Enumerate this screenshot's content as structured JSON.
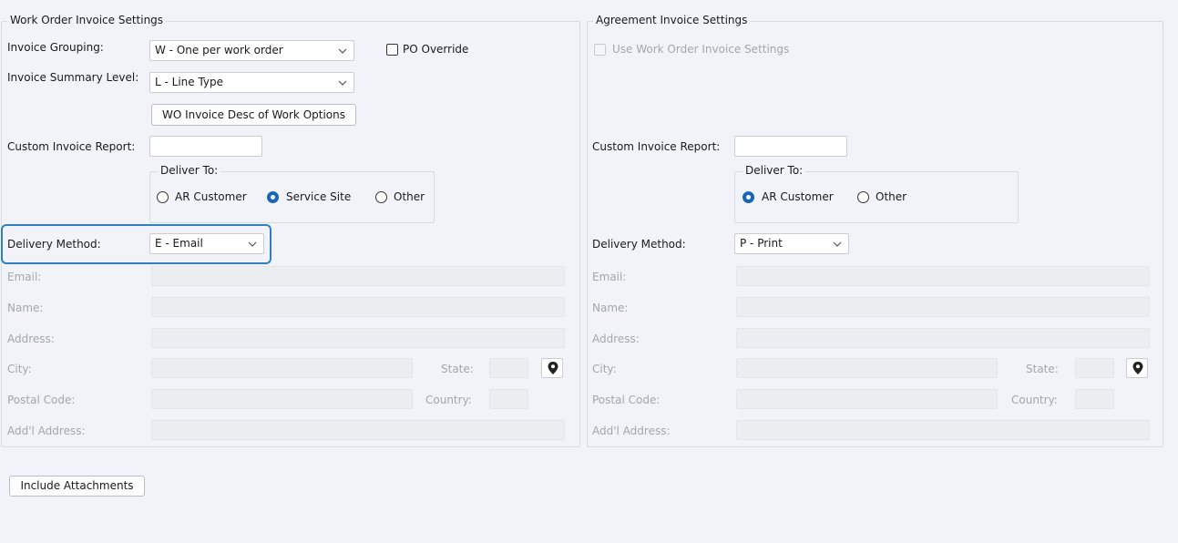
{
  "wo": {
    "title": "Work Order Invoice Settings",
    "invoice_grouping_label": "Invoice Grouping:",
    "invoice_grouping_value": "W - One per work order",
    "po_override_label": "PO Override",
    "summary_level_label": "Invoice Summary Level:",
    "summary_level_value": "L - Line Type",
    "desc_options_button": "WO Invoice Desc of Work Options",
    "custom_report_label": "Custom Invoice Report:",
    "deliver_to_title": "Deliver To:",
    "deliver_options": [
      "AR Customer",
      "Service Site",
      "Other"
    ],
    "deliver_selected": "Service Site",
    "delivery_method_label": "Delivery Method:",
    "delivery_method_value": "E - Email",
    "fields": {
      "email": "Email:",
      "name": "Name:",
      "address": "Address:",
      "city": "City:",
      "state": "State:",
      "postal": "Postal Code:",
      "country": "Country:",
      "addl": "Add'l Address:"
    }
  },
  "ag": {
    "title": "Agreement Invoice Settings",
    "use_wo_label": "Use Work Order Invoice Settings",
    "custom_report_label": "Custom Invoice Report:",
    "deliver_to_title": "Deliver To:",
    "deliver_options": [
      "AR Customer",
      "Other"
    ],
    "deliver_selected": "AR Customer",
    "delivery_method_label": "Delivery Method:",
    "delivery_method_value": "P - Print",
    "fields": {
      "email": "Email:",
      "name": "Name:",
      "address": "Address:",
      "city": "City:",
      "state": "State:",
      "postal": "Postal Code:",
      "country": "Country:",
      "addl": "Add'l Address:"
    }
  },
  "include_attachments_button": "Include Attachments",
  "colors": {
    "accent": "#1766b7",
    "highlight": "#2f7fc1",
    "background": "#f1f3f9"
  }
}
